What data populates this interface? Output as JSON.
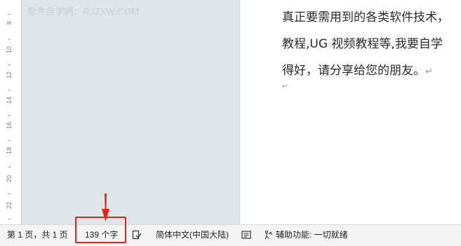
{
  "watermark": "软件自学网：RJZXW.COM",
  "ruler": {
    "labels": [
      "8",
      "10",
      "12",
      "14",
      "16",
      "18",
      "20",
      "22"
    ]
  },
  "document": {
    "lines": [
      "真正要需用到的各类软件技术，",
      "教程,UG  视频教程等,我要自学",
      "得好，请分享给您的朋友。"
    ],
    "paragraph_mark": "↵",
    "empty_paragraph_mark": "↵"
  },
  "status_bar": {
    "page_info": "第 1 页，共 1 页",
    "word_count": "139 个字",
    "language": "简体中文(中国大陆)",
    "accessibility": "辅助功能: 一切就绪"
  },
  "icons": {
    "proofing": "proofing-check-icon",
    "focus": "focus-mode-icon",
    "accessibility": "accessibility-icon"
  },
  "colors": {
    "highlight": "#e8231b",
    "canvas": "#dfe6ea"
  }
}
